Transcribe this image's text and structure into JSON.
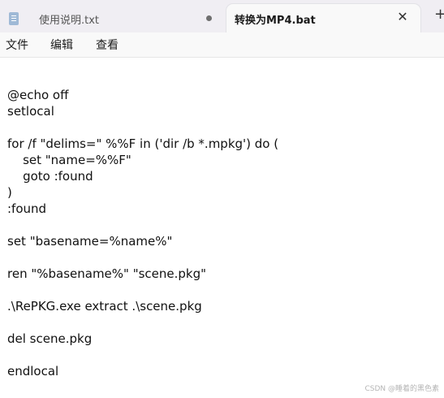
{
  "tabs": [
    {
      "label": "使用说明.txt",
      "modified": true
    },
    {
      "label": "转换为MP4.bat",
      "active": true
    }
  ],
  "tab_close": "✕",
  "new_tab": "+",
  "menu": {
    "file": "文件",
    "edit": "编辑",
    "view": "查看"
  },
  "editor": {
    "content": "@echo off\nsetlocal\n\nfor /f \"delims=\" %%F in ('dir /b *.mpkg') do (\n    set \"name=%%F\"\n    goto :found\n)\n:found\n\nset \"basename=%name%\"\n\nren \"%basename%\" \"scene.pkg\"\n\n.\\RePKG.exe extract .\\scene.pkg\n\ndel scene.pkg\n\nendlocal"
  },
  "watermark": "CSDN @睡着的黑色素",
  "icons": {
    "file": "notepad-file-icon",
    "modified": "unsaved-dot-icon",
    "close": "close-icon",
    "add": "plus-icon"
  }
}
